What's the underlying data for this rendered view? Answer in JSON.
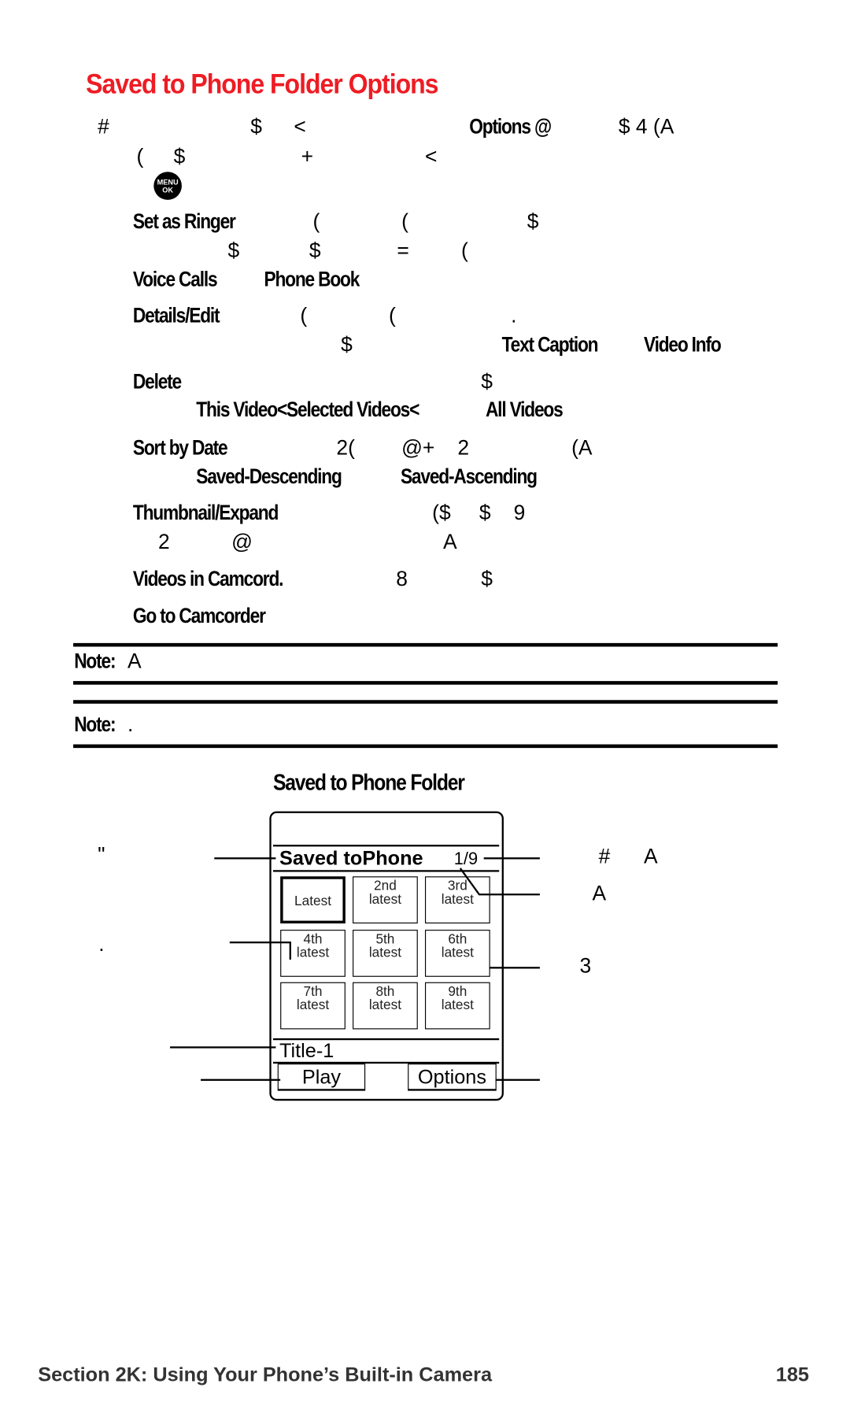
{
  "title": "Saved to Phone Folder Options",
  "intro": {
    "l1": [
      "#",
      "$",
      "<",
      "Options @",
      "$ 4 (A"
    ],
    "l2": [
      "(",
      "$",
      "+",
      "<"
    ]
  },
  "menu_icon": {
    "name": "menu-ok-key-icon",
    "label_top": "MENU",
    "label_bottom": "OK"
  },
  "options": {
    "set_as_ringer": {
      "label": "Set as Ringer",
      "l1": [
        "(",
        "(",
        "$"
      ],
      "l2": [
        "$",
        "$",
        "=",
        "("
      ],
      "targets": [
        "Voice Calls",
        "Phone Book"
      ]
    },
    "details_edit": {
      "label": "Details/Edit",
      "l1": [
        "(",
        "(",
        "."
      ],
      "l2": [
        "$"
      ],
      "targets": [
        "Text Caption",
        "Video Info"
      ]
    },
    "delete": {
      "label": "Delete",
      "l1": [
        "$"
      ],
      "targets": [
        "This Video<Selected Videos<",
        "All Videos"
      ]
    },
    "sort_by_date": {
      "label": "Sort by Date",
      "l1": [
        "2(",
        "@+",
        "2",
        "(A"
      ],
      "targets": [
        "Saved-Descending",
        "Saved-Ascending"
      ]
    },
    "thumbnail_expand": {
      "label": "Thumbnail/Expand",
      "l1": [
        "($",
        "$",
        "9"
      ],
      "l2": [
        "2",
        "@",
        "A"
      ]
    },
    "videos_in_camcord": {
      "label": "Videos in Camcord.",
      "l1": [
        "8",
        "$"
      ]
    },
    "go_to_camcorder": {
      "label": "Go to Camcorder"
    }
  },
  "notes": [
    {
      "label": "Note:",
      "text": "A"
    },
    {
      "label": "Note:",
      "text": "."
    }
  ],
  "figure": {
    "heading": "Saved to Phone Folder",
    "screen": {
      "header": "Saved toPhone",
      "counter": "1/9",
      "cells": [
        [
          "Latest"
        ],
        [
          "2nd",
          "latest"
        ],
        [
          "3rd",
          "latest"
        ],
        [
          "4th",
          "latest"
        ],
        [
          "5th",
          "latest"
        ],
        [
          "6th",
          "latest"
        ],
        [
          "7th",
          "latest"
        ],
        [
          "8th",
          "latest"
        ],
        [
          "9th",
          "latest"
        ]
      ],
      "title": "Title-1",
      "left_softkey": "Play",
      "right_softkey": "Options"
    },
    "callouts": {
      "left1": "\"",
      "left2": ".",
      "right1a": "#",
      "right1b": "A",
      "right2": "A",
      "right3": "3"
    }
  },
  "footer": {
    "section": "Section 2K: Using Your Phone’s Built-in Camera",
    "page": "185"
  }
}
